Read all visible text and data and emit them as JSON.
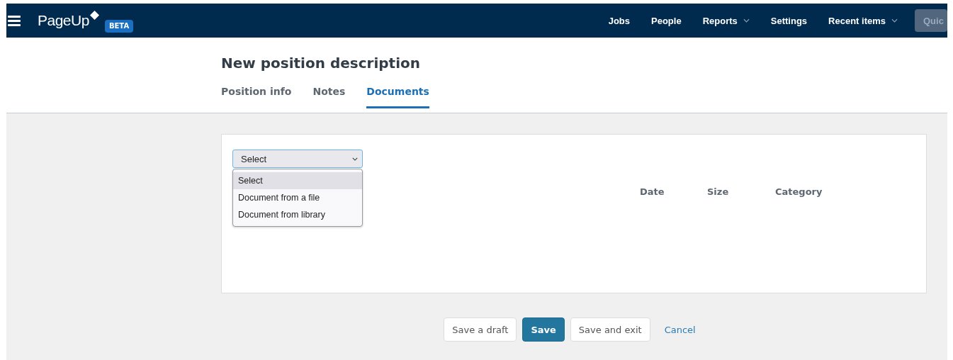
{
  "nav": {
    "logo": "PageUp",
    "badge": "BETA",
    "items": [
      {
        "label": "Jobs",
        "has_menu": false
      },
      {
        "label": "People",
        "has_menu": false
      },
      {
        "label": "Reports",
        "has_menu": true
      },
      {
        "label": "Settings",
        "has_menu": false
      },
      {
        "label": "Recent items",
        "has_menu": true
      }
    ],
    "search": {
      "placeholder": "Quic"
    }
  },
  "page_title": "New position description",
  "tabs": [
    {
      "label": "Position info",
      "selected": false
    },
    {
      "label": "Notes",
      "selected": false
    },
    {
      "label": "Documents",
      "selected": true
    }
  ],
  "add_select": {
    "value": "Select",
    "expanded": true,
    "options": [
      {
        "label": "Select",
        "selected": true
      },
      {
        "label": "Document from a file",
        "selected": false
      },
      {
        "label": "Document from library",
        "selected": false
      }
    ]
  },
  "table": {
    "columns": [
      "Date",
      "Size",
      "Category"
    ]
  },
  "buttons": [
    {
      "label": "Save a draft",
      "kind": "secondary"
    },
    {
      "label": "Save",
      "kind": "primary"
    },
    {
      "label": "Save and exit",
      "kind": "secondary"
    },
    {
      "label": "Cancel",
      "kind": "link"
    }
  ]
}
